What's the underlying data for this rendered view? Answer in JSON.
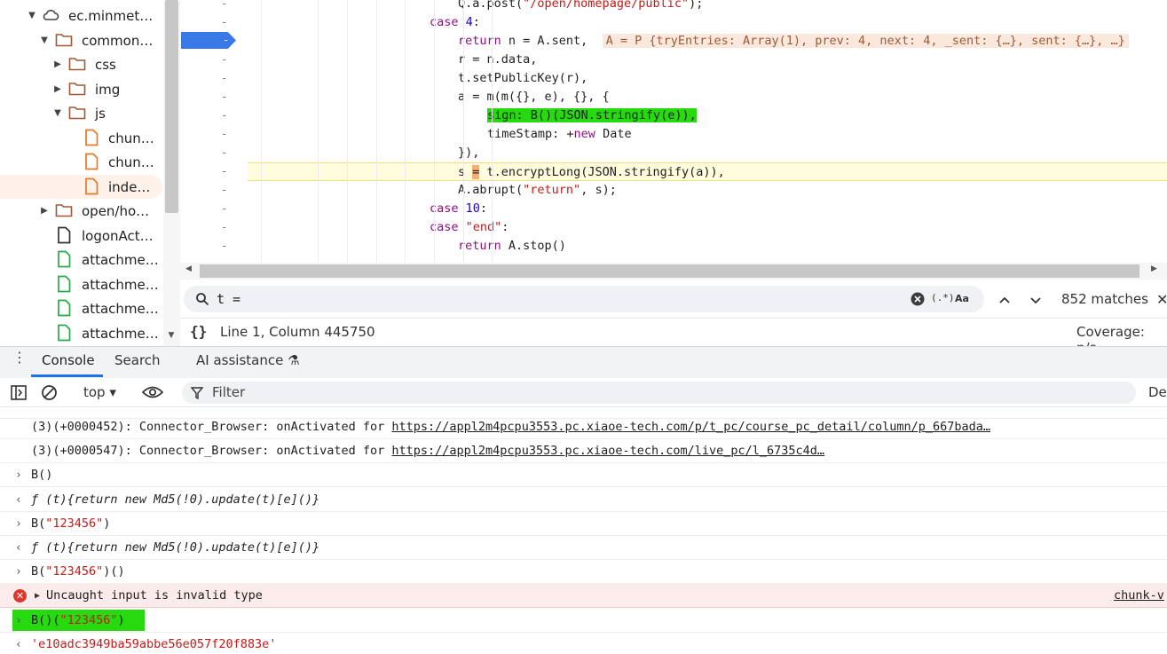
{
  "tree": {
    "items": [
      {
        "label": "ec.minmet…",
        "kind": "cloud",
        "expanded": true
      },
      {
        "label": "common…",
        "kind": "folder",
        "expanded": true
      },
      {
        "label": "css",
        "kind": "folder",
        "expanded": false
      },
      {
        "label": "img",
        "kind": "folder",
        "expanded": false
      },
      {
        "label": "js",
        "kind": "folder",
        "expanded": true
      },
      {
        "label": "chun…",
        "kind": "file-js"
      },
      {
        "label": "chun…",
        "kind": "file-js"
      },
      {
        "label": "inde…",
        "kind": "file-js",
        "selected": true
      },
      {
        "label": "open/ho…",
        "kind": "folder",
        "expanded": false
      },
      {
        "label": "logonAct…",
        "kind": "file-doc"
      },
      {
        "label": "attachme…",
        "kind": "file-other"
      },
      {
        "label": "attachme…",
        "kind": "file-other"
      },
      {
        "label": "attachme…",
        "kind": "file-other"
      },
      {
        "label": "attachme…",
        "kind": "file-other"
      }
    ]
  },
  "editor": {
    "breakpoint_label": "-",
    "gutter_mark": "-",
    "lines": [
      {
        "segs": [
          {
            "t": "Q.a.post("
          },
          {
            "t": "\"/open/homepage/public\"",
            "c": "str"
          },
          {
            "t": ");"
          }
        ]
      },
      {
        "segs": [
          {
            "t": "case ",
            "c": "kw"
          },
          {
            "t": "4",
            "c": "num"
          },
          {
            "t": ":"
          }
        ]
      },
      {
        "segs": [
          {
            "t": "return ",
            "c": "kw"
          },
          {
            "t": "n = A.sent,  "
          },
          {
            "t": "A = P {tryEntries: Array(1), prev: 4, next: 4, _sent: {…}, sent: {…}, …}",
            "c": "inl"
          }
        ]
      },
      {
        "segs": [
          {
            "t": "r = n.data,"
          }
        ]
      },
      {
        "segs": [
          {
            "t": "t.setPublicKey(r),"
          }
        ]
      },
      {
        "segs": [
          {
            "t": "a = m(m({}, e), {}, {"
          }
        ]
      },
      {
        "segs": [
          {
            "t": "sign: B()(JSON.stringify(e)),",
            "c": "grn"
          }
        ]
      },
      {
        "segs": [
          {
            "t": "timeStamp: +"
          },
          {
            "t": "new ",
            "c": "kw"
          },
          {
            "t": "Date"
          }
        ]
      },
      {
        "segs": [
          {
            "t": "}),"
          }
        ]
      },
      {
        "segs": [
          {
            "t": "s "
          },
          {
            "t": "=",
            "c": "hl"
          },
          {
            "t": " t.encryptLong(JSON.stringify(a)),"
          }
        ]
      },
      {
        "segs": [
          {
            "t": "A.abrupt("
          },
          {
            "t": "\"return\"",
            "c": "str"
          },
          {
            "t": ", s);"
          }
        ]
      },
      {
        "segs": [
          {
            "t": "case ",
            "c": "kw"
          },
          {
            "t": "10",
            "c": "num"
          },
          {
            "t": ":"
          }
        ]
      },
      {
        "segs": [
          {
            "t": "case ",
            "c": "kw"
          },
          {
            "t": "\"end\"",
            "c": "str"
          },
          {
            "t": ":"
          }
        ]
      },
      {
        "segs": [
          {
            "t": "return ",
            "c": "kw"
          },
          {
            "t": "A.stop()"
          }
        ]
      }
    ]
  },
  "search": {
    "query": "t =",
    "regex_label": "(.*)",
    "case_label": "Aa",
    "match_count": "852 matches",
    "close_label": "✕"
  },
  "status": {
    "braces": "{}",
    "cursor": "Line 1, Column 445750",
    "coverage": "Coverage: n/a"
  },
  "drawer": {
    "tabs": [
      "Console",
      "Search",
      "AI assistance"
    ],
    "active_tab": "Console"
  },
  "console_toolbar": {
    "context": "top ▾",
    "filter_placeholder": "Filter",
    "levels": "De"
  },
  "console": {
    "messages": [
      {
        "type": "log",
        "text": "(3)(+0000452): Connector_Browser: onActivated for ",
        "link": "https://appl2m4pcpu3553.pc.xiaoe-tech.com/p/t_pc/course_pc_detail/column/p_667bada…"
      },
      {
        "type": "log",
        "text": "(3)(+0000547): Connector_Browser: onActivated for ",
        "link": "https://appl2m4pcpu3553.pc.xiaoe-tech.com/live_pc/l_6735c4d…"
      },
      {
        "type": "input",
        "text": "B()"
      },
      {
        "type": "result-fn",
        "text": "ƒ (t){return new Md5(!0).update(t)[e]()}"
      },
      {
        "type": "input",
        "text": "B(\"123456\")"
      },
      {
        "type": "result-fn",
        "text": "ƒ (t){return new Md5(!0).update(t)[e]()}"
      },
      {
        "type": "input",
        "text": "B(\"123456\")()"
      },
      {
        "type": "error",
        "text": "Uncaught input is invalid type",
        "source": "chunk-v"
      },
      {
        "type": "input-hl",
        "text": "B()(\"123456\")"
      },
      {
        "type": "result-str",
        "text": "'e10adc3949ba59abbe56e057f20f883e'"
      }
    ]
  }
}
